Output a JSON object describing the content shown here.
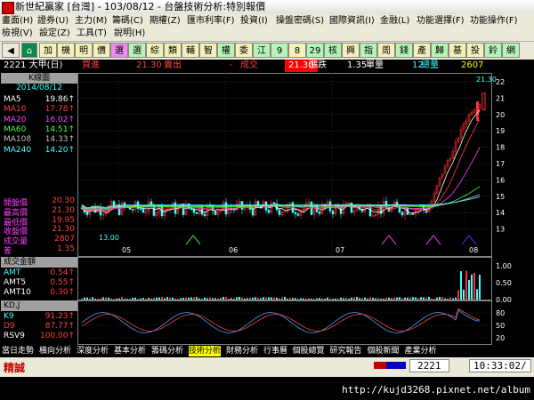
{
  "title": {
    "text": "新世紀贏家 [台灣] - 103/08/12 - 台盤技術分析:特別報價"
  },
  "menu": {
    "row1": [
      "畫面(H)",
      "證券(U)",
      "主力(M)",
      "籌碼(C)",
      "期權(Z)",
      "匯市利率(F)",
      "投資(I)",
      "操盤密碼(S)",
      "國際資訊(I)",
      "金融(L)",
      "功能選擇(F)",
      "功能操作(F)"
    ],
    "row2": [
      "檢視(V)",
      "設定(Z)",
      "工具(T)",
      "說明(H)"
    ]
  },
  "toolbar": {
    "buttons": [
      "加",
      "機",
      "明",
      "價",
      "選",
      "選",
      "綜",
      "類",
      "輔",
      "智",
      "權",
      "委",
      "江",
      "9",
      "8",
      "29",
      "核",
      "興",
      "指",
      "周",
      "錢",
      "產",
      "歸",
      "基",
      "投",
      "鈴",
      "網"
    ],
    "colors": [
      "#f4f1b8",
      "#f4f1b8",
      "#f4f1b8",
      "#f4f1b8",
      "#f08cf0",
      "#b6f4b6",
      "#f4f1b8",
      "#f4f1b8",
      "#f4f1b8",
      "#f4f1b8",
      "#b6f4b6",
      "#f4f1b8",
      "#b6f4b6",
      "#b6f4b6",
      "#f4f1b8",
      "#b6f4b6",
      "#b6f4b6",
      "#f4f1b8",
      "#b6f4b6",
      "#f4f1b8",
      "#b6f4b6",
      "#f4f1b8",
      "#b6f4b6",
      "#f4f1b8",
      "#f4f1b8",
      "#b6f4b6",
      "#b6f4b6"
    ]
  },
  "info": {
    "stock": "2221 大甲(日)",
    "buy_label": "買進",
    "buy_val": "21.30",
    "sell_label": "賣出",
    "sell_val": "-",
    "trade_label": "成交",
    "trade_val": "21.30",
    "change_label": "漲跌",
    "change_val": "1.35",
    "vol_label": "單量",
    "vol_val": "12",
    "total_label": "總量",
    "total_val": "2607"
  },
  "left": {
    "header": "K線圖",
    "date": "2014/08/12",
    "ma": [
      {
        "name": "MA5",
        "val": "19.86↑",
        "color": "#ffffff"
      },
      {
        "name": "MA10",
        "val": "17.78↑",
        "color": "#ff4040"
      },
      {
        "name": "MA20",
        "val": "16.02↑",
        "color": "#ff40ff"
      },
      {
        "name": "MA60",
        "val": "14.51↑",
        "color": "#40ff40"
      },
      {
        "name": "MA108",
        "val": "14.33↑",
        "color": "#c0c0c0"
      },
      {
        "name": "MA240",
        "val": "14.20↑",
        "color": "#40ffff"
      }
    ],
    "prices": [
      {
        "name": "開盤價",
        "val": "20.30"
      },
      {
        "name": "最高價",
        "val": "21.30"
      },
      {
        "name": "最低價",
        "val": "19.95"
      },
      {
        "name": "收盤價",
        "val": "21.30"
      },
      {
        "name": "成交量",
        "val": "2807"
      },
      {
        "name": "差",
        "val": "1.35"
      }
    ],
    "vol_header": "成交金額",
    "vol": [
      {
        "name": "AMT",
        "val": "0.54↑",
        "color": "#40ffff"
      },
      {
        "name": "AMT5",
        "val": "0.55↑",
        "color": "#ffffff"
      },
      {
        "name": "AMT10",
        "val": "0.30↑",
        "color": "#ffffff"
      }
    ],
    "kd_header": "KD,J",
    "kd": [
      {
        "name": "K9",
        "val": "91.23↑",
        "color": "#40ffff"
      },
      {
        "name": "D9",
        "val": "87.77↑",
        "color": "#ff4040"
      },
      {
        "name": "RSV9",
        "val": "100.00↑",
        "color": "#ffffff"
      }
    ]
  },
  "chart": {
    "yticks": [
      "22",
      "21",
      "20",
      "19",
      "18",
      "17",
      "16",
      "15",
      "14",
      "13"
    ],
    "xticks": [
      "05",
      "06",
      "07",
      "08"
    ],
    "high_label": "21.30",
    "low_label": "13.00",
    "vol_yticks": [
      "1.00",
      "0.50",
      "0.00"
    ],
    "kd_yticks": [
      "80",
      "50",
      "20"
    ]
  },
  "tabs": [
    "當日走勢",
    "橫向分析",
    "深度分析",
    "基本分析",
    "籌碼分析",
    "技術分析",
    "財務分析",
    "行事曆",
    "個股總覽",
    "研究報告",
    "個股新聞",
    "產業分析"
  ],
  "status": {
    "left_text": "精誠",
    "code": "2221",
    "time": "10:33:02/"
  },
  "watermark": "http://kujd3268.pixnet.net/album"
}
